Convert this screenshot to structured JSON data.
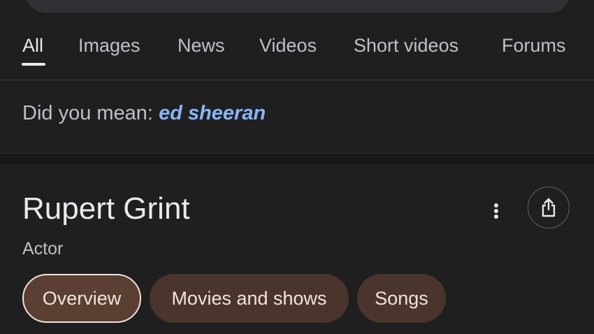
{
  "tabs": [
    {
      "label": "All",
      "active": true
    },
    {
      "label": "Images",
      "active": false
    },
    {
      "label": "News",
      "active": false
    },
    {
      "label": "Videos",
      "active": false
    },
    {
      "label": "Short videos",
      "active": false
    },
    {
      "label": "Forums",
      "active": false
    }
  ],
  "did_you_mean": {
    "prefix": "Did you mean:",
    "suggestion": "ed sheeran"
  },
  "knowledge_panel": {
    "title": "Rupert Grint",
    "subtitle": "Actor",
    "more_icon": "more-vert-icon",
    "share_icon": "share-icon",
    "chips": [
      {
        "label": "Overview",
        "selected": true
      },
      {
        "label": "Movies and shows",
        "selected": false
      },
      {
        "label": "Songs",
        "selected": false
      }
    ]
  },
  "colors": {
    "background": "#1f1f1f",
    "link": "#8ab4f8",
    "chip": "#4a352c",
    "chip_text": "#f1e4dc"
  }
}
